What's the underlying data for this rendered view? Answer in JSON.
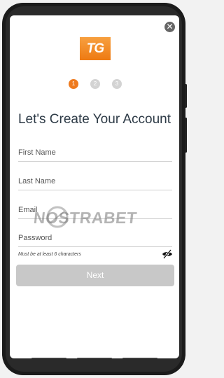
{
  "header": {
    "close_glyph": "✕",
    "logo_text": "TG"
  },
  "steps": [
    "1",
    "2",
    "3"
  ],
  "form": {
    "title": "Let's Create Your Account",
    "first_name_placeholder": "First Name",
    "last_name_placeholder": "Last Name",
    "email_placeholder": "Email",
    "password_placeholder": "Password",
    "password_hint": "Must be at least 6 characters",
    "next_label": "Next"
  },
  "watermark": {
    "text": "NOSTRABET"
  },
  "colors": {
    "accent": "#ee7a1e",
    "step_inactive": "#d3d3d3",
    "button_disabled": "#c8c8c8",
    "title": "#2d3a46"
  }
}
